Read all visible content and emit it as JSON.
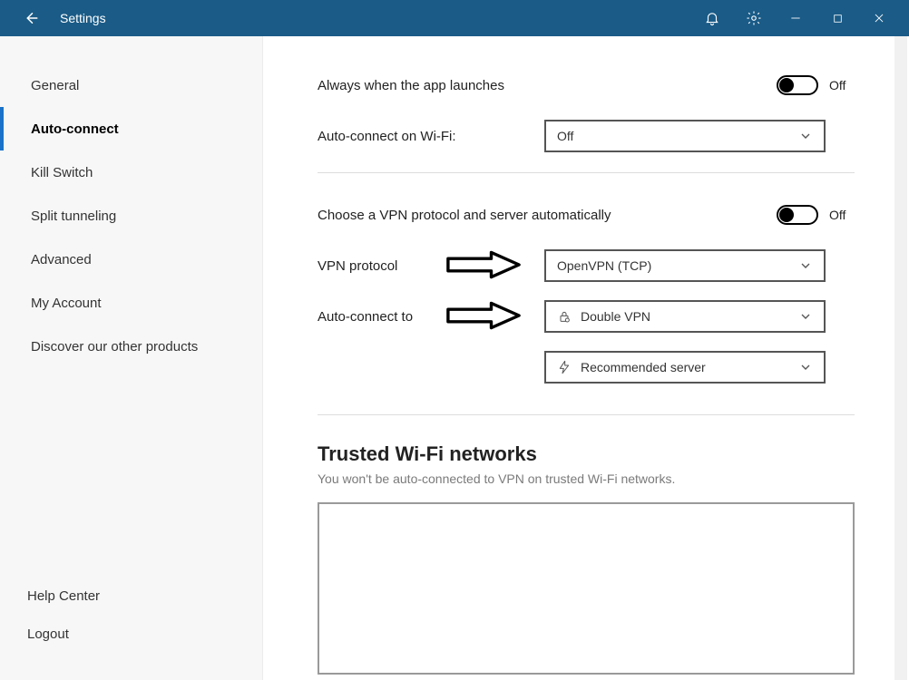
{
  "titlebar": {
    "title": "Settings"
  },
  "sidebar": {
    "items": [
      {
        "label": "General"
      },
      {
        "label": "Auto-connect"
      },
      {
        "label": "Kill Switch"
      },
      {
        "label": "Split tunneling"
      },
      {
        "label": "Advanced"
      },
      {
        "label": "My Account"
      },
      {
        "label": "Discover our other products"
      }
    ],
    "bottom": {
      "help": "Help Center",
      "logout": "Logout"
    }
  },
  "main": {
    "always_launch_label": "Always when the app launches",
    "always_launch_state": "Off",
    "wifi_label": "Auto-connect on Wi-Fi:",
    "wifi_value": "Off",
    "auto_protocol_label": "Choose a VPN protocol and server automatically",
    "auto_protocol_state": "Off",
    "vpn_protocol_label": "VPN protocol",
    "vpn_protocol_value": "OpenVPN (TCP)",
    "auto_connect_to_label": "Auto-connect to",
    "auto_connect_to_value": "Double VPN",
    "recommended_value": "Recommended server",
    "trusted_title": "Trusted Wi-Fi networks",
    "trusted_sub": "You won't be auto-connected to VPN on trusted Wi-Fi networks."
  }
}
